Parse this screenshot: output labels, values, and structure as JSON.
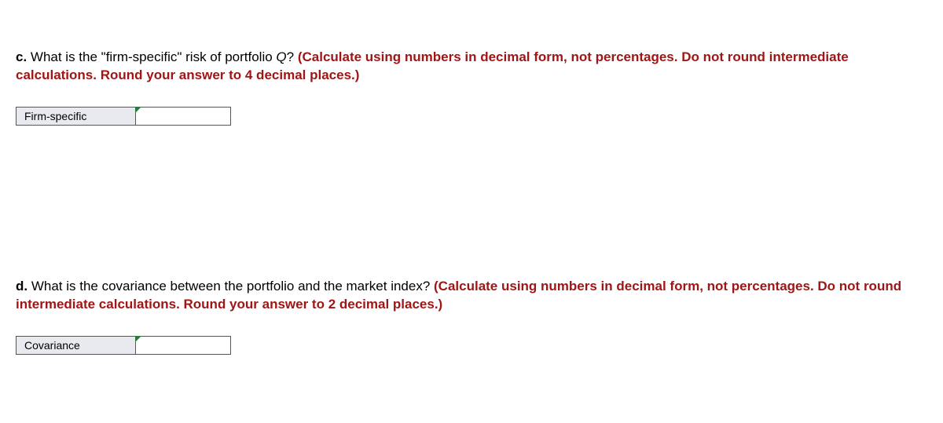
{
  "questions": {
    "c": {
      "marker": "c.",
      "text_part1": " What is the \"firm-specific\" risk of portfolio ",
      "text_italic": "Q",
      "text_part2": "? ",
      "instruction": "(Calculate using numbers in decimal form, not percentages. Do not round intermediate calculations. Round your answer to 4 decimal places.)",
      "answer_label": "Firm-specific",
      "answer_value": ""
    },
    "d": {
      "marker": "d.",
      "text_part1": " What is the covariance between the portfolio and the market index? ",
      "instruction": "(Calculate using numbers in decimal form, not percentages. Do not round intermediate calculations. Round your answer to 2 decimal places.)",
      "answer_label": "Covariance",
      "answer_value": ""
    }
  }
}
